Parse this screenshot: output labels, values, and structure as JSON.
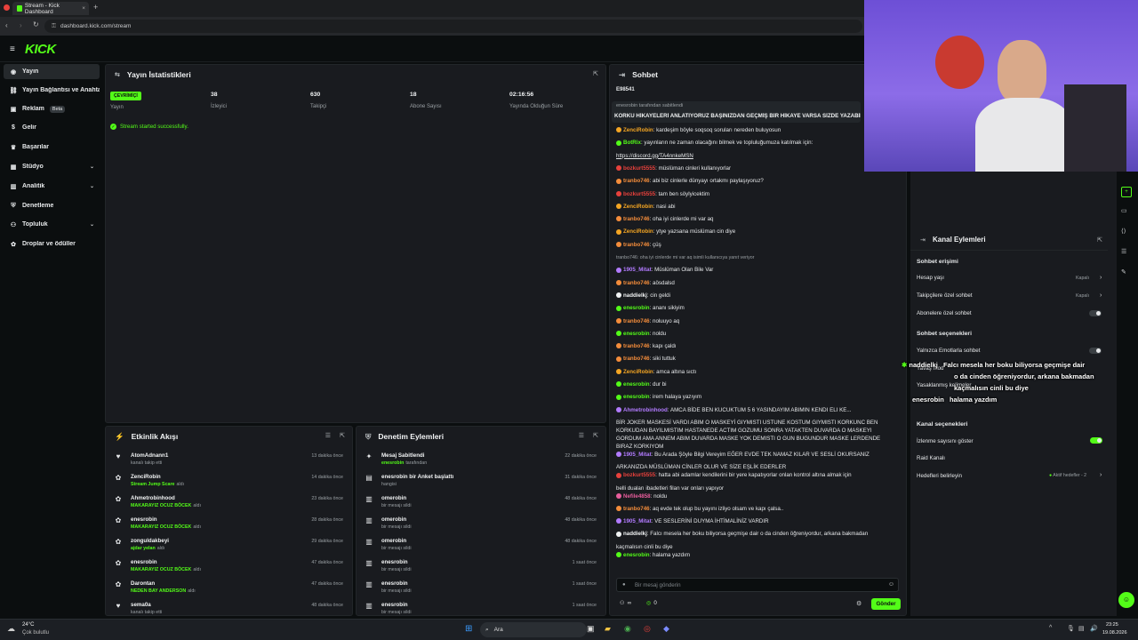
{
  "browser": {
    "tab_title": "Stream - Kick Dashboard",
    "url": "dashboard.kick.com/stream"
  },
  "app": {
    "logo": "KICK",
    "logo_color": "#53fc18"
  },
  "sidebar": {
    "items": [
      {
        "label": "Yayın",
        "icon": "broadcast-icon",
        "active": true
      },
      {
        "label": "Yayın Bağlantısı ve Anahtarı",
        "icon": "link-icon"
      },
      {
        "label": "Reklam",
        "icon": "ad-icon",
        "badge": "Beta"
      },
      {
        "label": "Gelir",
        "icon": "money-icon"
      },
      {
        "label": "Başarılar",
        "icon": "trophy-icon"
      },
      {
        "label": "Stüdyo",
        "icon": "studio-icon",
        "chevron": true
      },
      {
        "label": "Analitik",
        "icon": "analytics-icon",
        "chevron": true
      },
      {
        "label": "Denetleme",
        "icon": "shield-icon"
      },
      {
        "label": "Topluluk",
        "icon": "community-icon",
        "chevron": true
      },
      {
        "label": "Droplar ve ödüller",
        "icon": "gift-icon"
      }
    ]
  },
  "stats_panel": {
    "title": "Yayın İstatistikleri",
    "status_badge": "ÇEVRİMİÇİ",
    "status_label": "Yayın",
    "stats": [
      {
        "value": "38",
        "label": "İzleyici"
      },
      {
        "value": "630",
        "label": "Takipçi"
      },
      {
        "value": "18",
        "label": "Abone Sayısı"
      },
      {
        "value": "02:16:56",
        "label": "Yayında Olduğun Süre"
      }
    ],
    "success_message": "Stream started successfully."
  },
  "activity_feed": {
    "title": "Etkinlik Akışı",
    "rows": [
      {
        "icon": "heart-icon",
        "name": "AtomAdnann1",
        "sub": "kanalı takip etti",
        "sub_type": "grey",
        "time": "13 dakika önce"
      },
      {
        "icon": "gift-icon",
        "name": "ZenciRobin",
        "sub": "Stream Jump Scare",
        "sub_tail": "aldı",
        "sub_type": "green",
        "time": "14 dakika önce"
      },
      {
        "icon": "gift-icon",
        "name": "Ahmetrobinhood",
        "sub": "MAKARAYIZ OCUZ BÖCEK",
        "sub_tail": "aldı",
        "sub_type": "green",
        "time": "23 dakika önce"
      },
      {
        "icon": "gift-icon",
        "name": "enesrobin",
        "sub": "MAKARAYIZ OCUZ BÖCEK",
        "sub_tail": "aldı",
        "sub_type": "green",
        "time": "28 dakika önce"
      },
      {
        "icon": "gift-icon",
        "name": "zonguldakbeyi",
        "sub": "ajdar yelan",
        "sub_tail": "aldı",
        "sub_type": "green",
        "time": "29 dakika önce"
      },
      {
        "icon": "gift-icon",
        "name": "enesrobin",
        "sub": "MAKARAYIZ OCUZ BÖCEK",
        "sub_tail": "aldı",
        "sub_type": "green",
        "time": "47 dakika önce"
      },
      {
        "icon": "gift-icon",
        "name": "Darontan",
        "sub": "NEDEN BAY ANDERSON",
        "sub_tail": "aldı",
        "sub_type": "green",
        "time": "47 dakika önce"
      },
      {
        "icon": "heart-icon",
        "name": "sema0a",
        "sub": "kanalı takip etti",
        "sub_type": "grey",
        "time": "48 dakika önce"
      }
    ]
  },
  "moderation_panel": {
    "title": "Denetim Eylemleri",
    "rows": [
      {
        "icon": "pin-icon",
        "name": "Mesaj Sabitlendi",
        "sub": "enesrobin",
        "sub_tail": "tarafından",
        "sub_type": "green",
        "time": "22 dakika önce"
      },
      {
        "icon": "poll-icon",
        "name": "enesrobin bir Anket başlattı",
        "sub": "hangisi",
        "sub_type": "grey",
        "time": "31 dakika önce"
      },
      {
        "icon": "trash-icon",
        "name": "omerobin",
        "sub": "bir mesajı sildi",
        "sub_type": "grey",
        "time": "48 dakika önce"
      },
      {
        "icon": "trash-icon",
        "name": "omerobin",
        "sub": "bir mesajı sildi",
        "sub_type": "grey",
        "time": "48 dakika önce"
      },
      {
        "icon": "trash-icon",
        "name": "omerobin",
        "sub": "bir mesajı sildi",
        "sub_type": "grey",
        "time": "48 dakika önce"
      },
      {
        "icon": "trash-icon",
        "name": "enesrobin",
        "sub": "bir mesajı sildi",
        "sub_type": "grey",
        "time": "1 saat önce"
      },
      {
        "icon": "trash-icon",
        "name": "enesrobin",
        "sub": "bir mesajı sildi",
        "sub_type": "grey",
        "time": "1 saat önce"
      },
      {
        "icon": "trash-icon",
        "name": "enesrobin",
        "sub": "bir mesajı sildi",
        "sub_type": "grey",
        "time": "1 saat önce"
      }
    ]
  },
  "chat": {
    "title": "Sohbet",
    "pinned_top": "E98541",
    "pinned_banner": "KORKU HİKAYELERİ ANLATIYORUZ BAŞINIZDAN GEÇMİŞ BİR HİKAYE VARSA SİZDE YAZABİLİRSİNİZ",
    "pinned_by": "enesrobin tarafından sabitlendi",
    "messages": [
      {
        "name": "ZenciRobin",
        "color": "#f5a623",
        "text": "kardeşim böyle soqsoq soruları nereden buluyosun"
      },
      {
        "name": "BotRix",
        "color": "#53fc18",
        "text": "yayınların ne zaman olacağını bilmek ve topluluğumuza katılmak için:"
      },
      {
        "name": "",
        "color": "#53fc18",
        "text": "https://discord.gg/TA4nnkeMSN"
      },
      {
        "name": "bozkurt5555",
        "color": "#e8413c",
        "text": "müslüman cinleri kullanıyorlar"
      },
      {
        "name": "tranbo746",
        "color": "#f58d3b",
        "text": "abi biz cinlerle dünyayı ortakmı paylaşıyoruz?"
      },
      {
        "name": "bozkurt5555",
        "color": "#e8413c",
        "text": "tam ben söylyicektim"
      },
      {
        "name": "ZenciRobin",
        "color": "#f5a623",
        "text": "nasi abi"
      },
      {
        "name": "tranbo746",
        "color": "#f58d3b",
        "text": "oha iyi cinlerde mi var aq"
      },
      {
        "name": "ZenciRobin",
        "color": "#f5a623",
        "text": "ytye yazsana müslüman cin diye"
      },
      {
        "name": "tranbo746",
        "color": "#f58d3b",
        "text": "çüş"
      },
      {
        "name": "",
        "color": "#9aa0a4",
        "text": "tranbo746: oha iyi cinlerde mi var aq isimli kullanıcıya yanıt veriyor"
      },
      {
        "name": "1905_Mitat",
        "color": "#b27bff",
        "text": "Müslüman Olan Bile Var"
      },
      {
        "name": "tranbo746",
        "color": "#f58d3b",
        "text": "aösdalsd"
      },
      {
        "name": "naddielkj",
        "color": "#f1f3f4",
        "text": "cin geldi"
      },
      {
        "name": "enesrobin",
        "color": "#53fc18",
        "text": "ananı sikiyim"
      },
      {
        "name": "tranbo746",
        "color": "#f58d3b",
        "text": "noluuyo aq"
      },
      {
        "name": "enesrobin",
        "color": "#53fc18",
        "text": "noldu"
      },
      {
        "name": "tranbo746",
        "color": "#f58d3b",
        "text": "kapı çaldı"
      },
      {
        "name": "tranbo746",
        "color": "#f58d3b",
        "text": "siki tuttuk"
      },
      {
        "name": "ZenciRobin",
        "color": "#f5a623",
        "text": "amca altına sıctı"
      },
      {
        "name": "enesrobin",
        "color": "#53fc18",
        "text": "dur bi"
      },
      {
        "name": "enesrobin",
        "color": "#53fc18",
        "text": "irem halaya yazıyım"
      },
      {
        "name": "Ahmetrobinhood",
        "color": "#b27bff",
        "text": "AMCA BİDE BEN KUCUKTUM 5 6 YASINDAYIM ABIMIN KENDI ELI KE..."
      },
      {
        "name": "",
        "color": "#f1f3f4",
        "text": "BİR JOKER MASKESİ VARDI ABIM O MASKEYİ GIYMISTI USTUNE KOSTUM GIYMISTI KORKUNC BEN"
      },
      {
        "name": "",
        "color": "#f1f3f4",
        "text": "KORKUDAN BAYILMISTIM HASTANEDE ACTIM GOZUMU SONRA YATAKTEN DUVARDA O MASKEYI"
      },
      {
        "name": "",
        "color": "#f1f3f4",
        "text": "GORDUM AMA ANNEM ABIM DUVARDA MASKE YOK DEMISTI O GUN BUGUNDUR MASKE LERDENDE"
      },
      {
        "name": "",
        "color": "#f1f3f4",
        "text": "BIRAZ KORKIYOM"
      },
      {
        "name": "1905_Mitat",
        "color": "#b27bff",
        "text": "Bu Arada Şöyle Bilgi Vereyim EĞER EVDE TEK NAMAZ KILAR VE SESLİ OKURSANIZ"
      },
      {
        "name": "",
        "color": "#f1f3f4",
        "text": "ARKANIZDA MÜSLÜMAN CİNLER OLUR VE SİZE EŞLİK EDERLER"
      },
      {
        "name": "bozkurt5555",
        "color": "#e8413c",
        "text": "hatta abi adamlar kendilerini bir yere kapatıyorlar onlan kontrol altına almak için"
      },
      {
        "name": "",
        "color": "#f1f3f4",
        "text": "belli duaları ibadetleri filan var onları yapıyor"
      },
      {
        "name": "Nefile4858",
        "color": "#e85d9c",
        "text": "noldu"
      },
      {
        "name": "tranbo746",
        "color": "#f58d3b",
        "text": "aq evde tek olup bu yayını izliyo olsam ve kapı çalsa.."
      },
      {
        "name": "1905_Mitat",
        "color": "#b27bff",
        "text": "VE SESLERİNİ DUYMA İHTİMALİNİZ VARDIR"
      },
      {
        "name": "naddielkj",
        "color": "#f1f3f4",
        "text": "Falcı mesela her boku biliyorsa geçmişe dair o da cinden öğreniyordur, arkana bakmadan"
      },
      {
        "name": "",
        "color": "#f1f3f4",
        "text": "kaçmalısın cinli bu diye"
      },
      {
        "name": "enesrobin",
        "color": "#53fc18",
        "text": "halama yazdım"
      }
    ],
    "input_placeholder": "Bir mesaj gönderin",
    "points": "0",
    "send_label": "Gönder"
  },
  "overlay": {
    "name": "naddielkj",
    "line1": "Falcı mesela her boku biliyorsa geçmişe dair",
    "line2": "o da cinden öğreniyordur, arkana bakmadan",
    "line3": "kaçmalısın cinli bu diye",
    "line4_name": "enesrobin",
    "line4": "halama yazdım"
  },
  "channel_actions": {
    "title": "Kanal Eylemleri",
    "chat_access_title": "Sohbet erişimi",
    "rows": [
      {
        "label": "Hesap yaşı",
        "value": "Kapalı"
      },
      {
        "label": "Takipçilere özel sohbet",
        "value": "Kapalı"
      },
      {
        "label": "Abonelere özel sohbet",
        "value": ""
      }
    ],
    "chat_options_title": "Sohbet seçenekleri",
    "emote_only": "Yalnızca Emotlarla sohbet",
    "slow_mode": "Yavaş mod",
    "banned_words": "Yasaklanmış kelimeler",
    "channel_options_title": "Kanal seçenekleri",
    "show_viewers": "İzlenme sayısını göster",
    "raid": "Raid Kanalı",
    "goals": "Hedefleri belirleyin",
    "goals_value": "Aktif hedefler - 2"
  },
  "taskbar": {
    "weather_temp": "24°C",
    "weather_text": "Çok bulutlu",
    "search": "Ara",
    "time": "23:25",
    "date": "19.08.2026"
  }
}
